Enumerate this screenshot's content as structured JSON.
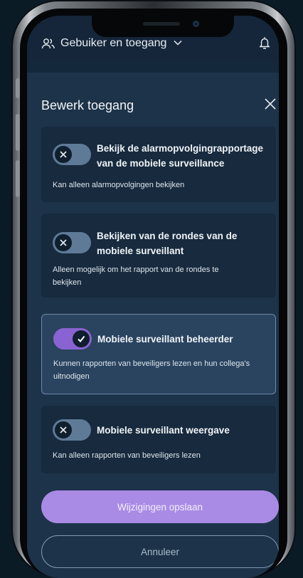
{
  "topbar": {
    "title": "Gebuiker en toegang",
    "icons": {
      "user": "user-group-icon",
      "dropdown": "chevron-down-icon",
      "notification": "bell-icon"
    }
  },
  "dialog": {
    "title": "Bewerk toegang",
    "close_icon": "close-icon"
  },
  "permissions": [
    {
      "title_line1": "Bekijk de alarmopvolgingrapportage",
      "title_line2": "van de mobiele surveillance",
      "description": "Kan alleen alarmopvolgingen bekijken",
      "enabled": false,
      "selected": false
    },
    {
      "title_line1": "Bekijken van de rondes van de",
      "title_line2": "mobiele surveillant",
      "description_line1": "Alleen mogelijk om het rapport van de rondes te",
      "description_line2": "bekijken",
      "enabled": false,
      "selected": false
    },
    {
      "title_line1": "Mobiele surveillant beheerder",
      "description_line1": "Kunnen rapporten van beveiligers lezen en hun collega's",
      "description_line2": "uitnodigen",
      "enabled": true,
      "selected": true
    },
    {
      "title_line1": "Mobiele surveillant weergave",
      "description": "Kan alleen rapporten van beveiligers lezen",
      "enabled": false,
      "selected": false
    }
  ],
  "actions": {
    "save_label": "Wijzigingen opslaan",
    "cancel_label": "Annuleer"
  },
  "colors": {
    "background": "#0b1b26",
    "panel": "#1d3349",
    "card": "#172a3e",
    "card_selected": "#2a4460",
    "toggle_on": "#8a63d2",
    "toggle_off": "#5e7a96",
    "primary_button": "#a98be6"
  }
}
